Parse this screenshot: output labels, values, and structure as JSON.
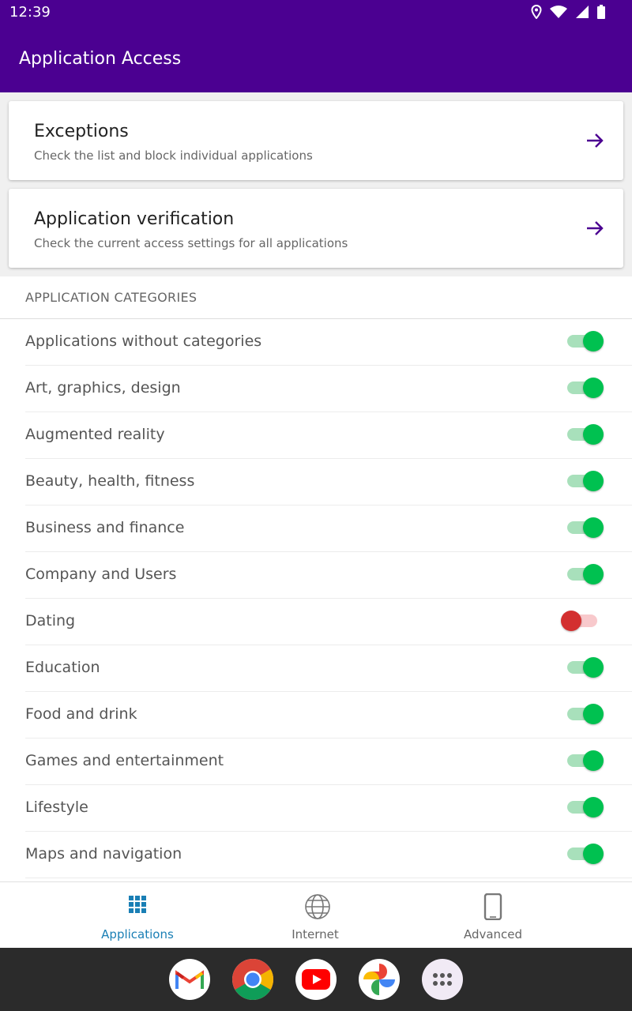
{
  "status": {
    "time": "12:39"
  },
  "header": {
    "title": "Application Access"
  },
  "cards": [
    {
      "title": "Exceptions",
      "subtitle": "Check the list and block individual applications"
    },
    {
      "title": "Application verification",
      "subtitle": "Check the current access settings for all applications"
    }
  ],
  "categories": {
    "header": "APPLICATION CATEGORIES",
    "items": [
      {
        "label": "Applications without categories",
        "enabled": true
      },
      {
        "label": "Art, graphics, design",
        "enabled": true
      },
      {
        "label": "Augmented reality",
        "enabled": true
      },
      {
        "label": "Beauty, health, fitness",
        "enabled": true
      },
      {
        "label": "Business and finance",
        "enabled": true
      },
      {
        "label": "Company and Users",
        "enabled": true
      },
      {
        "label": "Dating",
        "enabled": false
      },
      {
        "label": "Education",
        "enabled": true
      },
      {
        "label": "Food and drink",
        "enabled": true
      },
      {
        "label": "Games and entertainment",
        "enabled": true
      },
      {
        "label": "Lifestyle",
        "enabled": true
      },
      {
        "label": "Maps and navigation",
        "enabled": true
      }
    ]
  },
  "bottom_nav": [
    {
      "label": "Applications",
      "icon": "grid-icon",
      "active": true
    },
    {
      "label": "Internet",
      "icon": "globe-icon",
      "active": false
    },
    {
      "label": "Advanced",
      "icon": "phone-icon",
      "active": false
    }
  ],
  "dock": [
    {
      "icon": "gmail-icon"
    },
    {
      "icon": "chrome-icon"
    },
    {
      "icon": "youtube-icon"
    },
    {
      "icon": "photos-icon"
    },
    {
      "icon": "app-drawer-icon"
    }
  ],
  "colors": {
    "primary": "#4b0091",
    "toggle_on": "#00c150",
    "toggle_off": "#d32f2f",
    "nav_active": "#1a7fb5"
  }
}
